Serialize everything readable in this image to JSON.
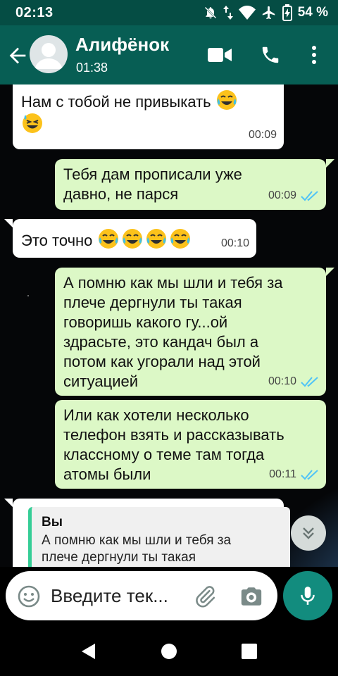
{
  "status_bar": {
    "time": "02:13",
    "battery_percent": "54 %",
    "icons": [
      "mute-icon",
      "data-arrows-icon",
      "wifi-icon",
      "airplane-icon",
      "battery-charging-icon"
    ]
  },
  "header": {
    "contact_name": "Алифёнок",
    "subtitle": "01:38",
    "icons": [
      "back-arrow-icon",
      "avatar",
      "video-call-icon",
      "phone-icon",
      "more-vert-icon"
    ]
  },
  "messages": [
    {
      "direction": "in",
      "lines": [
        "Нам с тобой не привыкать"
      ],
      "emoji_after": [
        "face-with-tears-of-joy",
        "grinning-squinting-face-with-sweat"
      ],
      "time": "00:09"
    },
    {
      "direction": "out",
      "lines": [
        "Тебя дам прописали уже",
        "давно, не парся"
      ],
      "time": "00:09",
      "status": "read"
    },
    {
      "direction": "in",
      "lines": [
        "Это точно"
      ],
      "emoji_after": [
        "face-with-tears-of-joy",
        "face-with-tears-of-joy",
        "face-with-tears-of-joy",
        "face-with-tears-of-joy"
      ],
      "time": "00:10"
    },
    {
      "direction": "out",
      "lines": [
        "А помню как мы шли и тебя за",
        "плече дергнули ты такая",
        "говоришь какого гу...ой",
        "здрасьте, это кандач был а",
        "потом как угорали над этой",
        "ситуацией"
      ],
      "time": "00:10",
      "status": "read"
    },
    {
      "direction": "out",
      "lines": [
        "Или как хотели несколько",
        "телефон взять и рассказывать",
        "классному о теме там тогда",
        "атомы были"
      ],
      "time": "00:11",
      "status": "read"
    },
    {
      "direction": "in",
      "reply": {
        "author": "Вы",
        "lines": [
          "А помню как мы шли и тебя за",
          "плече дергнули ты такая"
        ]
      }
    }
  ],
  "composer": {
    "placeholder": "Введите тек...",
    "icons": [
      "emoji-icon",
      "attach-icon",
      "camera-icon",
      "mic-icon"
    ]
  },
  "colors": {
    "status_bar": "#054d44",
    "header": "#075e54",
    "incoming_bubble": "#ffffff",
    "outgoing_bubble": "#dcf8c6",
    "read_ticks": "#4fc3f7",
    "mic_button": "#128c7e",
    "reply_bar": "#35cd96"
  }
}
